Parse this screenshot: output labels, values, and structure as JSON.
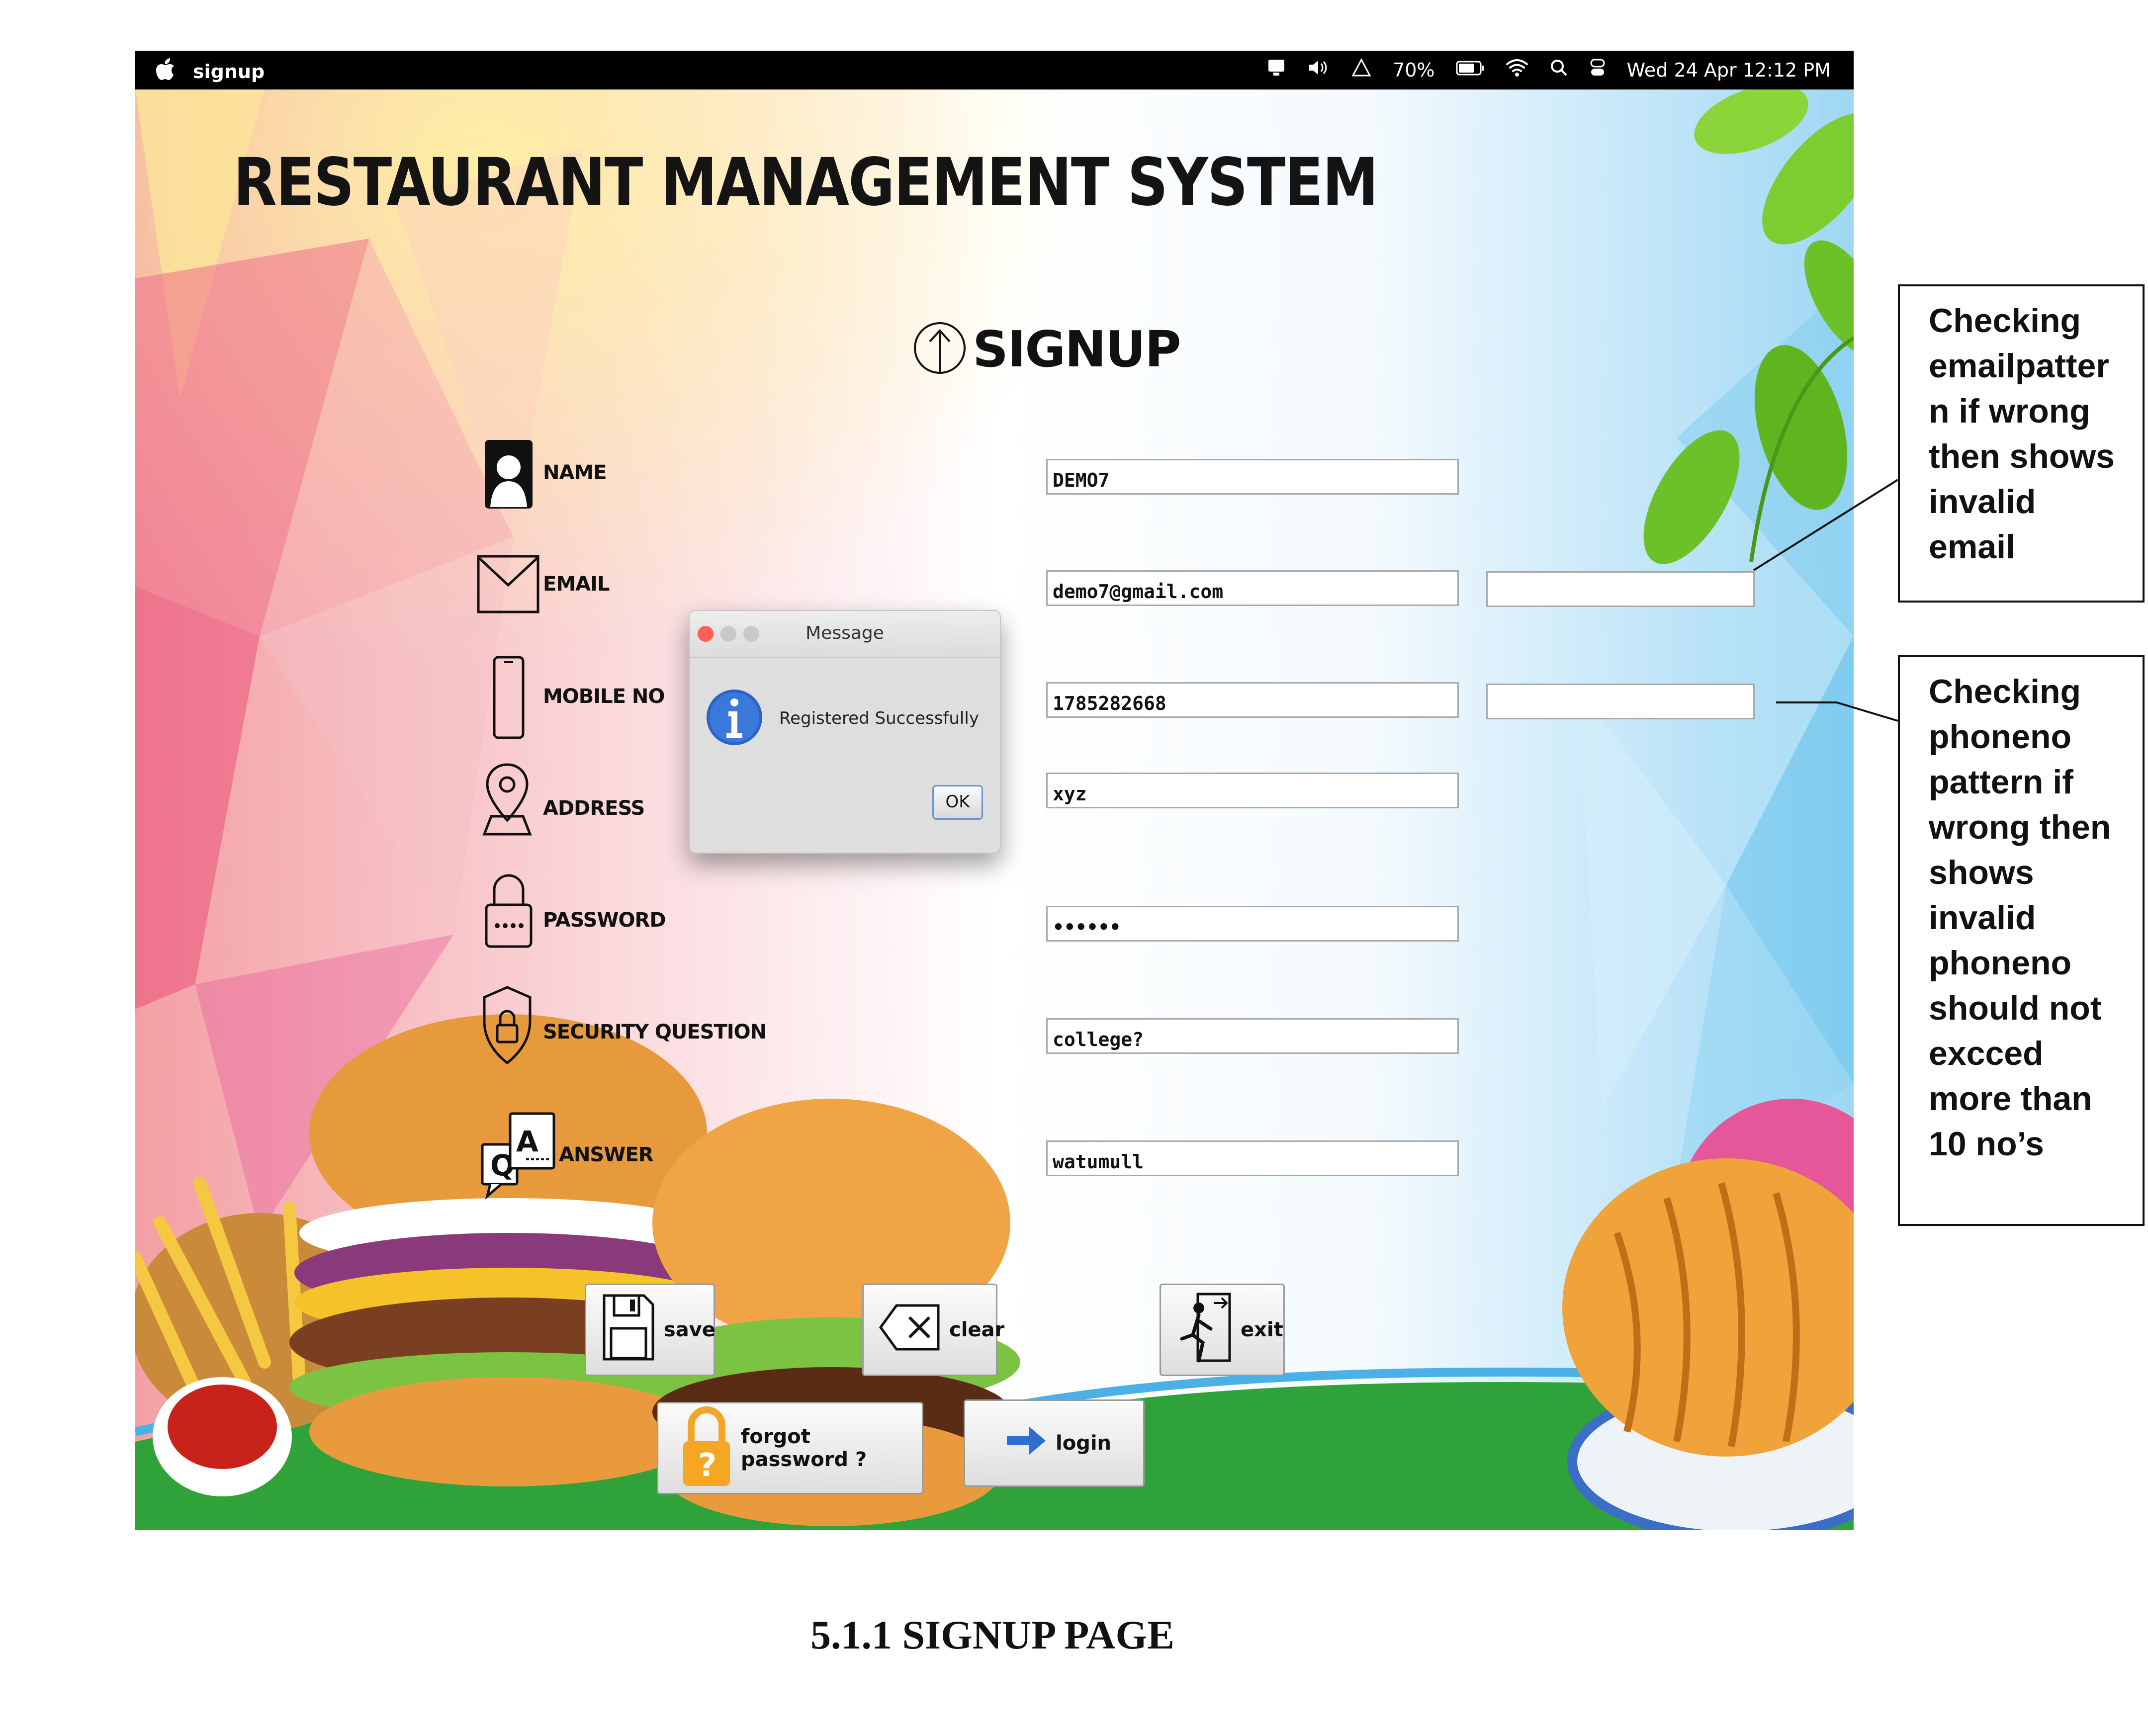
{
  "menubar": {
    "app_name": "signup",
    "battery": "70%",
    "clock": "Wed 24 Apr  12:12 PM",
    "icons": [
      "apple-icon",
      "display-icon",
      "volume-icon",
      "network-icon",
      "battery-icon",
      "wifi-icon",
      "search-icon",
      "control-center-icon"
    ]
  },
  "app": {
    "title": "RESTAURANT MANAGEMENT SYSTEM",
    "subtitle": "SIGNUP",
    "fields": {
      "name": {
        "label": "NAME",
        "value": "DEMO7"
      },
      "email": {
        "label": "EMAIL",
        "value": "demo7@gmail.com"
      },
      "mobile": {
        "label": "MOBILE NO",
        "value": "1785282668"
      },
      "address": {
        "label": "ADDRESS",
        "value": "xyz"
      },
      "password": {
        "label": "PASSWORD",
        "value": "••••••"
      },
      "security": {
        "label": "SECURITY QUESTION",
        "value": "college?"
      },
      "answer": {
        "label": "ANSWER",
        "value": "watumull"
      }
    },
    "buttons": {
      "save": "save",
      "clear": "clear",
      "exit": "exit",
      "forgot": "forgot password ?",
      "login": "login"
    }
  },
  "dialog": {
    "title": "Message",
    "message": "Registered Successfully",
    "ok": "OK"
  },
  "annotations": {
    "email": [
      "Checking",
      "emailpatter",
      "n if wrong",
      "then shows",
      "invalid",
      "email"
    ],
    "phone": [
      "Checking",
      "phoneno",
      "pattern if",
      "wrong then",
      "shows",
      "invalid",
      "phoneno",
      "should not",
      "excced",
      "more than",
      "10 no’s"
    ]
  },
  "caption": "5.1.1 SIGNUP PAGE",
  "colors": {
    "menubar": "#000000",
    "field_border": "#a9a9a9",
    "accent_blue": "#2f6fd0",
    "lock_orange": "#f5a623"
  }
}
